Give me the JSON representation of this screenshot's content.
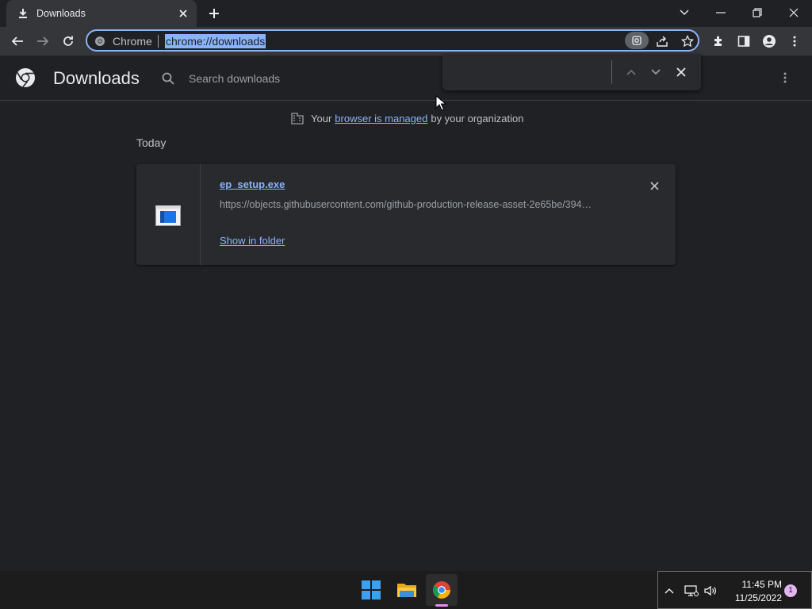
{
  "tab": {
    "title": "Downloads"
  },
  "omnibox": {
    "chip": "Chrome",
    "url": "chrome://downloads"
  },
  "downloads_page": {
    "title": "Downloads",
    "search_placeholder": "Search downloads"
  },
  "managed_notice": {
    "before": "Your",
    "link": "browser is managed",
    "after": "by your organization"
  },
  "section_label": "Today",
  "download": {
    "file_name": "ep_setup.exe",
    "url": "https://objects.githubusercontent.com/github-production-release-asset-2e65be/394…",
    "show_in_folder": "Show in folder"
  },
  "taskbar": {
    "time": "11:45 PM",
    "date": "11/25/2022",
    "notification_count": "1"
  },
  "colors": {
    "background": "#202124",
    "toolbar": "#35363a",
    "accent": "#8ab4f8",
    "card": "#292a2d"
  }
}
